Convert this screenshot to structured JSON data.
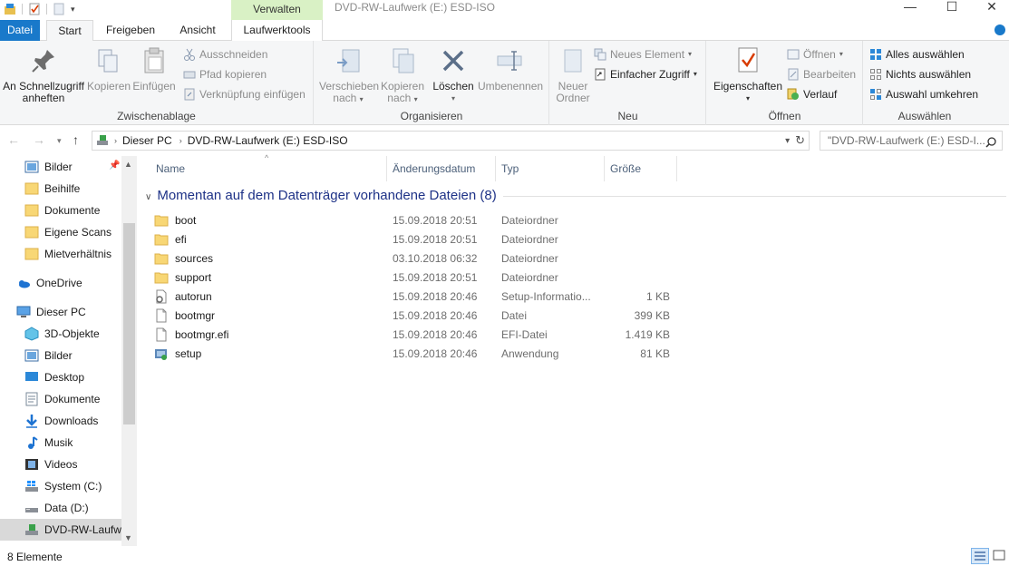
{
  "window": {
    "title": "DVD-RW-Laufwerk (E:) ESD-ISO",
    "context_tab_group": "Verwalten",
    "minimize": "—",
    "maximize": "☐",
    "close": "✕"
  },
  "tabs": {
    "datei": "Datei",
    "start": "Start",
    "freigeben": "Freigeben",
    "ansicht": "Ansicht",
    "laufwerktools": "Laufwerktools"
  },
  "ribbon": {
    "zwischenablage": {
      "label": "Zwischenablage",
      "pin_line1": "An Schnellzugriff",
      "pin_line2": "anheften",
      "kopieren": "Kopieren",
      "einfuegen": "Einfügen",
      "ausschneiden": "Ausschneiden",
      "pfad_kopieren": "Pfad kopieren",
      "verknuepfung": "Verknüpfung einfügen"
    },
    "organisieren": {
      "label": "Organisieren",
      "verschieben_line1": "Verschieben",
      "verschieben_line2": "nach",
      "kopieren_line1": "Kopieren",
      "kopieren_line2": "nach",
      "loeschen": "Löschen",
      "umbenennen": "Umbenennen"
    },
    "neu": {
      "label": "Neu",
      "ordner_line1": "Neuer",
      "ordner_line2": "Ordner",
      "neues_element": "Neues Element",
      "einfacher_zugriff": "Einfacher Zugriff"
    },
    "oeffnen": {
      "label": "Öffnen",
      "eigenschaften": "Eigenschaften",
      "oeffnen": "Öffnen",
      "bearbeiten": "Bearbeiten",
      "verlauf": "Verlauf"
    },
    "auswaehlen": {
      "label": "Auswählen",
      "alles": "Alles auswählen",
      "nichts": "Nichts auswählen",
      "umkehren": "Auswahl umkehren"
    }
  },
  "address": {
    "crumb1": "Dieser PC",
    "crumb2": "DVD-RW-Laufwerk (E:) ESD-ISO",
    "search_placeholder": "\"DVD-RW-Laufwerk (E:) ESD-I..."
  },
  "sidebar": {
    "quick": [
      "Bilder",
      "Beihilfe",
      "Dokumente",
      "Eigene Scans",
      "Mietverhältnis"
    ],
    "onedrive": "OneDrive",
    "thispc": "Dieser PC",
    "pc_items": [
      "3D-Objekte",
      "Bilder",
      "Desktop",
      "Dokumente",
      "Downloads",
      "Musik",
      "Videos",
      "System (C:)",
      "Data (D:)",
      "DVD-RW-Laufwerk (E:) ESD-ISO"
    ]
  },
  "columns": {
    "name": "Name",
    "date": "Änderungsdatum",
    "type": "Typ",
    "size": "Größe"
  },
  "group_header": "Momentan auf dem Datenträger vorhandene Dateien (8)",
  "files": [
    {
      "name": "boot",
      "date": "15.09.2018 20:51",
      "type": "Dateiordner",
      "size": "",
      "icon": "folder-icon"
    },
    {
      "name": "efi",
      "date": "15.09.2018 20:51",
      "type": "Dateiordner",
      "size": "",
      "icon": "folder-icon"
    },
    {
      "name": "sources",
      "date": "03.10.2018 06:32",
      "type": "Dateiordner",
      "size": "",
      "icon": "folder-icon"
    },
    {
      "name": "support",
      "date": "15.09.2018 20:51",
      "type": "Dateiordner",
      "size": "",
      "icon": "folder-icon"
    },
    {
      "name": "autorun",
      "date": "15.09.2018 20:46",
      "type": "Setup-Informatio...",
      "size": "1 KB",
      "icon": "setup-info-icon"
    },
    {
      "name": "bootmgr",
      "date": "15.09.2018 20:46",
      "type": "Datei",
      "size": "399 KB",
      "icon": "file-icon"
    },
    {
      "name": "bootmgr.efi",
      "date": "15.09.2018 20:46",
      "type": "EFI-Datei",
      "size": "1.419 KB",
      "icon": "file-icon"
    },
    {
      "name": "setup",
      "date": "15.09.2018 20:46",
      "type": "Anwendung",
      "size": "81 KB",
      "icon": "setup-app-icon"
    }
  ],
  "status": {
    "count": "8 Elemente"
  }
}
